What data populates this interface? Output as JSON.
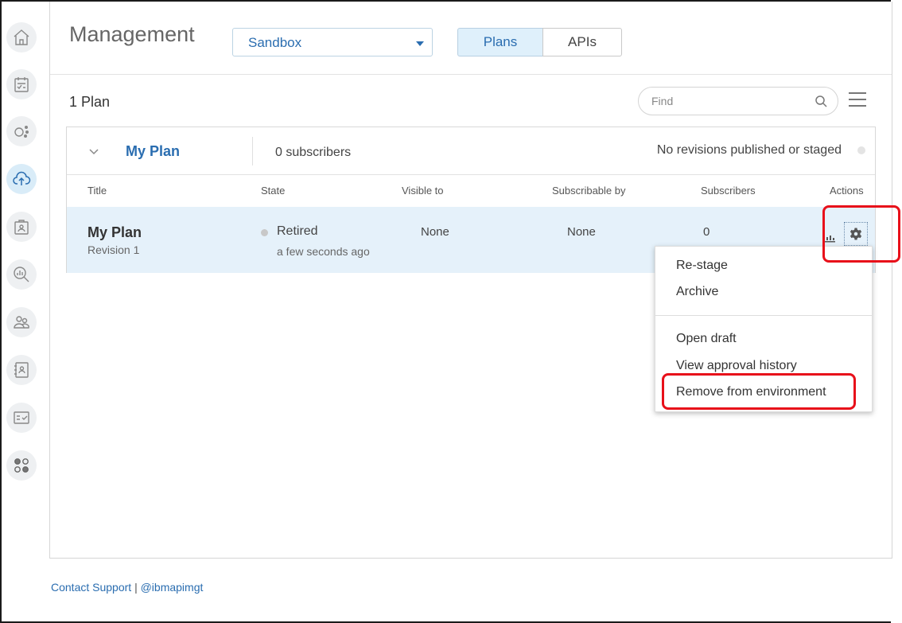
{
  "header": {
    "title": "Management",
    "environment": "Sandbox",
    "tabs": [
      {
        "label": "Plans",
        "active": true
      },
      {
        "label": "APIs",
        "active": false
      }
    ]
  },
  "toolbar": {
    "count": "1 Plan",
    "find_placeholder": "Find"
  },
  "plan_card": {
    "name": "My Plan",
    "subscribers": "0 subscribers",
    "publish_status": "No revisions published or staged",
    "columns": [
      "Title",
      "State",
      "Visible to",
      "Subscribable by",
      "Subscribers",
      "Actions"
    ],
    "row": {
      "title": "My Plan",
      "revision": "Revision 1",
      "state": "Retired",
      "state_time": "a few seconds ago",
      "visible_to": "None",
      "subscribable_by": "None",
      "subscribers": "0"
    }
  },
  "actions_menu": {
    "items": [
      {
        "label": "Re-stage"
      },
      {
        "label": "Archive"
      },
      {
        "label": "Open draft"
      },
      {
        "label": "View approval history"
      },
      {
        "label": "Remove from environment",
        "highlighted": true
      }
    ]
  },
  "footer": {
    "support": "Contact Support",
    "separator": "|",
    "handle": "@ibmapimgt"
  },
  "colors": {
    "accent": "#2a6db0",
    "row_highlight": "#e5f1fa",
    "annotation": "#e8101a"
  },
  "left_nav": [
    "home-icon",
    "calendar-checklist-icon",
    "nodes-icon",
    "cloud-upload-icon",
    "clipboard-user-icon",
    "analytics-search-icon",
    "community-icon",
    "contact-card-icon",
    "task-card-icon",
    "apps-icon"
  ]
}
